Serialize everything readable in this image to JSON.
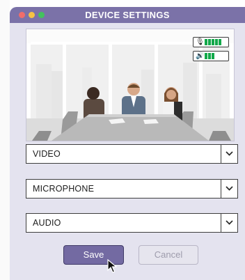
{
  "window": {
    "title": "DEVICE SETTINGS"
  },
  "preview": {
    "mic_level_bars": 5,
    "speaker_level_bars": 3,
    "mic_icon": "microphone-icon",
    "speaker_icon": "speaker-icon"
  },
  "dropdowns": [
    {
      "label": "VIDEO"
    },
    {
      "label": "MICROPHONE"
    },
    {
      "label": "AUDIO"
    }
  ],
  "buttons": {
    "save": "Save",
    "cancel": "Cancel"
  },
  "colors": {
    "accent": "#7b72a8",
    "level_green": "#13a84a",
    "panel": "#e4e3ef"
  }
}
